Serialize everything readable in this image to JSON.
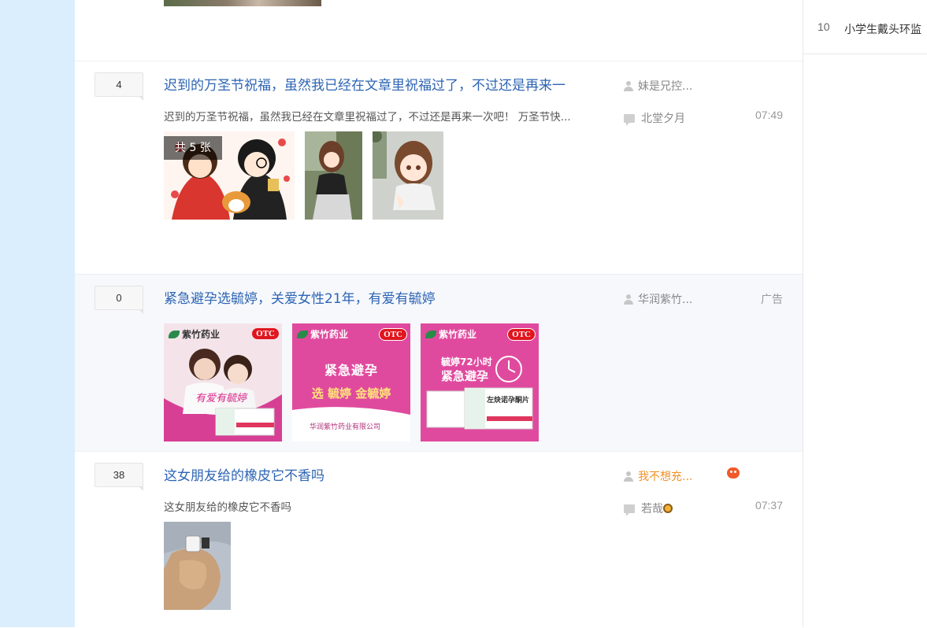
{
  "threads": [
    {
      "replies": "4",
      "title": "迟到的万圣节祝福，虽然我已经在文章里祝福过了，不过还是再来一",
      "abstract": "迟到的万圣节祝福，虽然我已经在文章里祝福过了，不过还是再来一次吧！ 万圣节快...",
      "author": "妹是兄控...",
      "last_replier": "北堂夕月",
      "time": "07:49",
      "image_count_label": "共 5 张"
    },
    {
      "replies": "0",
      "title": "紧急避孕选毓婷，关爱女性21年，有爱有毓婷",
      "author": "华润紫竹...",
      "ad_label": "广告",
      "ad_images": [
        {
          "brand": "紫竹药业",
          "badge": "OTC",
          "caption": "有爱有毓婷"
        },
        {
          "brand": "紫竹药业",
          "badge": "OTC",
          "headline": "紧急避孕",
          "line2": "选 毓婷 金毓婷",
          "footer": "华润紫竹药业有限公司"
        },
        {
          "brand": "紫竹药业",
          "badge": "OTC",
          "headline1": "毓婷72小时",
          "headline2": "紧急避孕",
          "box_label": "左炔诺孕酮片"
        }
      ]
    },
    {
      "replies": "38",
      "title": "这女朋友给的橡皮它不香吗",
      "abstract": "这女朋友给的橡皮它不香吗",
      "author": "我不想充...",
      "last_replier": "若哉",
      "time": "07:37"
    }
  ],
  "sidebar": {
    "rank_items": [
      {
        "num": "10",
        "text": "小学生戴头环监"
      }
    ]
  },
  "colors": {
    "left_strip": "#dbeefd",
    "title_blue": "#2d64b3",
    "ad_pink": "#d9429a",
    "author_orange": "#f0922a"
  }
}
